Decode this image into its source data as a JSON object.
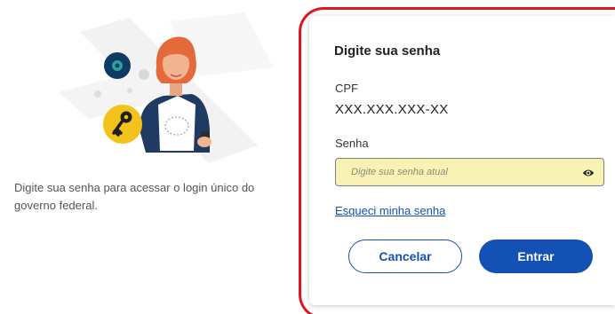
{
  "left_panel": {
    "description": "Digite sua senha para acessar o login único do governo federal."
  },
  "card": {
    "title": "Digite sua senha",
    "cpf_label": "CPF",
    "cpf_value": "XXX.XXX.XXX-XX",
    "password_label": "Senha",
    "password_placeholder": "Digite sua senha atual",
    "password_value": "",
    "toggle_visibility_icon": "eye-icon",
    "forgot_password_link": "Esqueci minha senha",
    "cancel_button": "Cancelar",
    "submit_button": "Entrar"
  },
  "colors": {
    "primary": "#1351b4",
    "field_background": "#f8f3b4",
    "highlight_border": "#e0161e",
    "illustration_key_badge": "#f2c31b",
    "illustration_coin": "#0f3a63"
  }
}
